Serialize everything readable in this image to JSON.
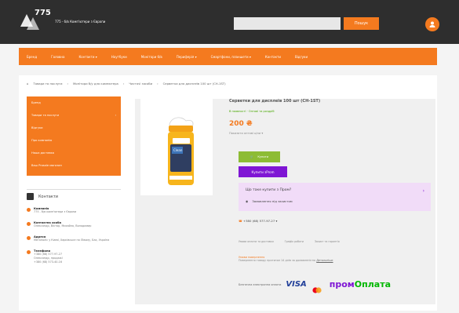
{
  "header": {
    "brand": "775",
    "tagline": "775 - б/в Комп'ютери з Європи",
    "search_button": "Пошук",
    "search_placeholder": ""
  },
  "nav": {
    "items": [
      "Бренд",
      "Головна",
      "Контакти ▾",
      "Ноутбуки",
      "Монітори б/в",
      "Периферія ▾",
      "Смартфони, планшети ▾",
      "Контакти",
      "Відгуки"
    ]
  },
  "breadcrumb": {
    "items": [
      "Товари та послуги",
      "Монітори б/у для компютера",
      "Чистячі засоби",
      "Серветки для дисплеїв 100 шт (CH-1ST)"
    ]
  },
  "sidebar": {
    "items": [
      "Бренд",
      "Товари та послуги",
      "Відгуки",
      "Про компанію",
      "Наша доставка",
      "Ваш Prosale магазин"
    ]
  },
  "contacts": {
    "heading": "Контакти",
    "company_label": "Компанія",
    "company_value": "775 - б/в комп'ютери з Європи",
    "person_label": "Контактна особа",
    "person_value": "Олександр, Віктор, Михайло, Володимир",
    "address_label": "Адреса",
    "address_value": "Мегаполіс у Києві, Харківське по Лівому, Бах, Україна",
    "phone_label": "Телефони",
    "phone_value": "+380 (68) 577-97-27",
    "phone_extra": "Олександр, продажі",
    "phone_value_2": "+380 (68) 573-40-16"
  },
  "product": {
    "title": "Серветки для дисплеїв 100 шт (CH-1ST)",
    "stock": "В наявності · Оптові та роздріб",
    "price": "200 ₴",
    "price_note": "Показати оптові ціни ▾",
    "buy_label": "Купити",
    "prom_buy_label": "Купити з ",
    "prom_logo": "Prom",
    "prom_question": "Що таке купити з Пром?",
    "prom_protect": "Замовлення під захистом",
    "phone": "+380 (68) 577-97-27 ▾",
    "links": [
      "Умови оплати та доставки",
      "Графік роботи",
      "Захист та гарантія"
    ],
    "warranty_title": "Умови повернення",
    "warranty_text": "Повернення товару протягом 14 днів за домовленістю",
    "warranty_link": "Детальніше",
    "payment_label": "Безпечна електронна оплата",
    "visa": "VISA",
    "promplat": "пром",
    "promplat_green": "Оплата"
  },
  "colors": {
    "orange": "#f47a1f",
    "purple": "#7f16d4",
    "green": "#8dbc34",
    "dark": "#2e2e2e"
  }
}
